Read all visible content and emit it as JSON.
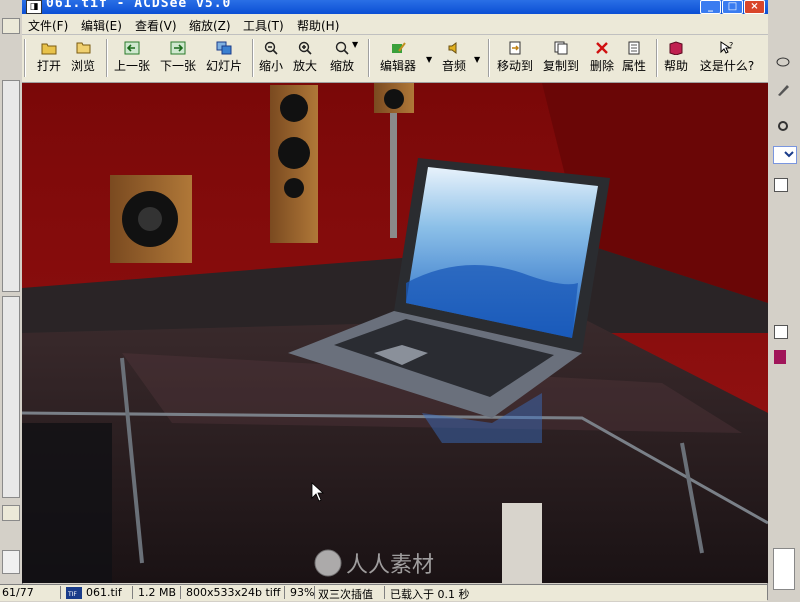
{
  "window": {
    "title": "061.tif - ACDSee v5.0",
    "app_icon": "acdsee-icon",
    "controls": {
      "minimize": "_",
      "maximize": "□",
      "close": "×"
    }
  },
  "menu": [
    {
      "label": "文件(F)"
    },
    {
      "label": "编辑(E)"
    },
    {
      "label": "查看(V)"
    },
    {
      "label": "缩放(Z)"
    },
    {
      "label": "工具(T)"
    },
    {
      "label": "帮助(H)"
    }
  ],
  "toolbar": {
    "open": "打开",
    "browse": "浏览",
    "prev": "上一张",
    "next": "下一张",
    "slideshow": "幻灯片",
    "zoom_out": "缩小",
    "zoom_in": "放大",
    "zoom": "缩放",
    "editor": "编辑器",
    "audio": "音频",
    "move_to": "移动到",
    "copy_to": "复制到",
    "delete": "删除",
    "properties": "属性",
    "help": "帮助",
    "whats_this": "这是什么?"
  },
  "status": {
    "index": "61/77",
    "filename": "061.tif",
    "filesize": "1.2 MB",
    "dimensions": "800x533x24b tiff",
    "zoom": "93%",
    "resample": "双三次插值",
    "load_time": "已载入于 0.1 秒"
  },
  "watermark": {
    "text": "人人素材"
  },
  "colors": {
    "titlebar": "#0b4fd4",
    "wall": "#8a0d0d",
    "laptop_screen": "#3a7fd0"
  }
}
